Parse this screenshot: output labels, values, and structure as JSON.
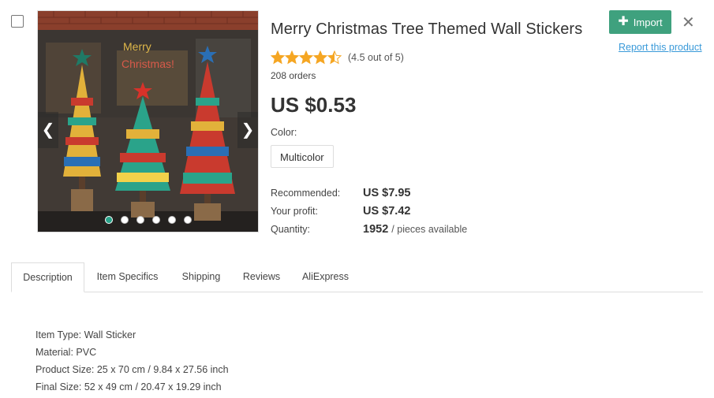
{
  "product": {
    "title": "Merry Christmas Tree Themed Wall Stickers",
    "rating_text": "(4.5 out of 5)",
    "rating_value": 4.5,
    "orders": "208 orders",
    "price": "US $0.53",
    "color_label": "Color:",
    "color_option": "Multicolor",
    "recommended_label": "Recommended:",
    "recommended_value": "US $7.95",
    "profit_label": "Your profit:",
    "profit_value": "US $7.42",
    "quantity_label": "Quantity:",
    "quantity_value": "1952",
    "quantity_unit": "/ pieces available"
  },
  "gallery": {
    "image_text_1": "Merry",
    "image_text_2": "Christmas!",
    "prev_icon": "chevron-left-icon",
    "next_icon": "chevron-right-icon",
    "dots_count": 6,
    "active_dot": 1
  },
  "actions": {
    "import_label": "Import",
    "report_label": "Report this product",
    "close_icon": "close-icon",
    "accent_color": "#3fa17e",
    "link_color": "#3a9ad9"
  },
  "tabs": [
    {
      "label": "Description",
      "active": true
    },
    {
      "label": "Item Specifics",
      "active": false
    },
    {
      "label": "Shipping",
      "active": false
    },
    {
      "label": "Reviews",
      "active": false
    },
    {
      "label": "AliExpress",
      "active": false
    }
  ],
  "description": [
    "Item Type: Wall Sticker",
    "Material: PVC",
    "Product Size: 25 x 70 cm / 9.84 x 27.56 inch",
    "Final Size: 52 x 49 cm / 20.47 x 19.29 inch"
  ]
}
